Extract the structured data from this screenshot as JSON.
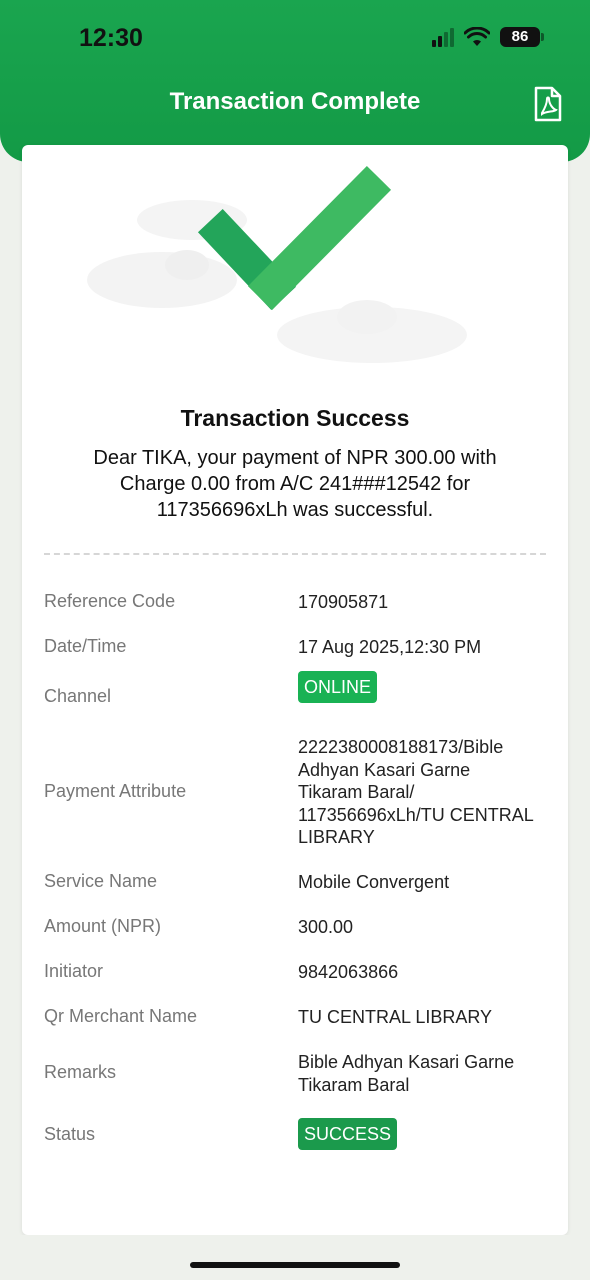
{
  "status_bar": {
    "time": "12:30",
    "battery": "86"
  },
  "header": {
    "title": "Transaction Complete",
    "pdf_icon": "pdf-file-icon"
  },
  "result": {
    "title": "Transaction Success",
    "message_line1": "Dear TIKA, your payment of NPR 300.00 with",
    "message_line2": "Charge 0.00 from A/C 241###12542 for",
    "message_line3": "117356696xLh was successful."
  },
  "details": {
    "reference_code": {
      "label": "Reference Code",
      "value": "170905871"
    },
    "date_time": {
      "label": "Date/Time",
      "value": "17 Aug 2025,12:30 PM"
    },
    "channel": {
      "label": "Channel",
      "value": "ONLINE"
    },
    "payment_attribute": {
      "label": "Payment Attribute",
      "line1": "2222380008188173/Bible",
      "line2": "Adhyan Kasari Garne",
      "line3": "Tikaram Baral/",
      "line4": "117356696xLh/TU CENTRAL",
      "line5": "LIBRARY"
    },
    "service_name": {
      "label": "Service Name",
      "value": "Mobile Convergent"
    },
    "amount": {
      "label": "Amount (NPR)",
      "value": "300.00"
    },
    "initiator": {
      "label": "Initiator",
      "value": "9842063866"
    },
    "qr_merchant": {
      "label": "Qr Merchant Name",
      "value": "TU CENTRAL LIBRARY"
    },
    "remarks": {
      "label": "Remarks",
      "line1": "Bible Adhyan Kasari Garne",
      "line2": "Tikaram Baral"
    },
    "status": {
      "label": "Status",
      "value": "SUCCESS"
    }
  },
  "colors": {
    "brand_green": "#139a46",
    "badge_online": "#19b254",
    "badge_success": "#1b9a4c"
  }
}
